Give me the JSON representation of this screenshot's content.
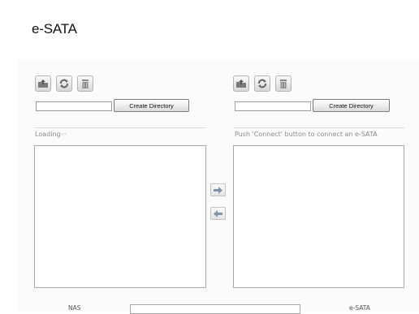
{
  "page": {
    "title": "e-SATA"
  },
  "left_pane": {
    "icons": [
      "upload-folder-icon",
      "refresh-icon",
      "trash-icon"
    ],
    "directory_input_value": "",
    "create_directory_label": "Create Directory",
    "status": "Loading···",
    "footer_label": "NAS"
  },
  "right_pane": {
    "icons": [
      "upload-folder-icon",
      "refresh-icon",
      "trash-icon"
    ],
    "directory_input_value": "",
    "create_directory_label": "Create Directory",
    "status": "Push 'Connect' button to connect an e-SATA",
    "footer_label": "e-SATA"
  },
  "transfer": {
    "icons": [
      "arrow-right-icon",
      "arrow-left-icon"
    ]
  },
  "footer": {
    "path_value": ""
  },
  "colors": {
    "icon_fill": "#777777",
    "border": "#a8a8a8"
  }
}
